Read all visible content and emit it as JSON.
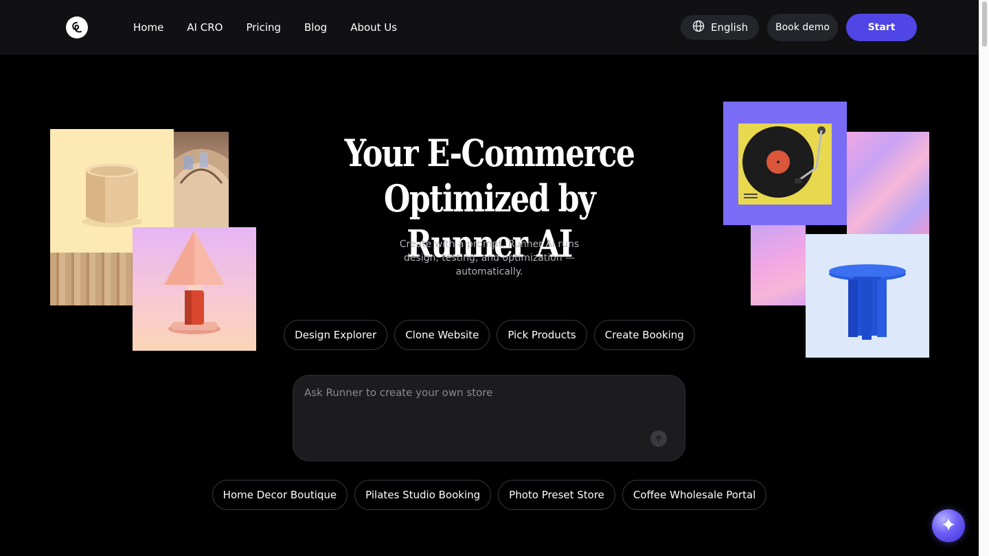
{
  "header": {
    "nav": [
      "Home",
      "AI CRO",
      "Pricing",
      "Blog",
      "About Us"
    ],
    "language": "English",
    "book_demo": "Book demo",
    "start": "Start"
  },
  "hero": {
    "title_line1": "Your E-Commerce",
    "title_line2": "Optimized by Runner AI",
    "subtitle": "Create with a prompt. Runner AI runs design, testing, and optimization — automatically."
  },
  "actions": [
    "Design Explorer",
    "Clone Website",
    "Pick Products",
    "Create Booking"
  ],
  "prompt": {
    "placeholder": "Ask Runner to create your own store"
  },
  "examples": [
    "Home Decor Boutique",
    "Pilates Studio Booking",
    "Photo Preset Store",
    "Coffee Wholesale Portal"
  ],
  "colors": {
    "accent": "#4f46e5",
    "header_bg": "#111113",
    "page_bg": "#000000"
  },
  "icons": {
    "logo": "runner-logo-icon",
    "language": "globe-icon",
    "send": "arrow-up-icon",
    "assistant": "sparkle-icon"
  }
}
